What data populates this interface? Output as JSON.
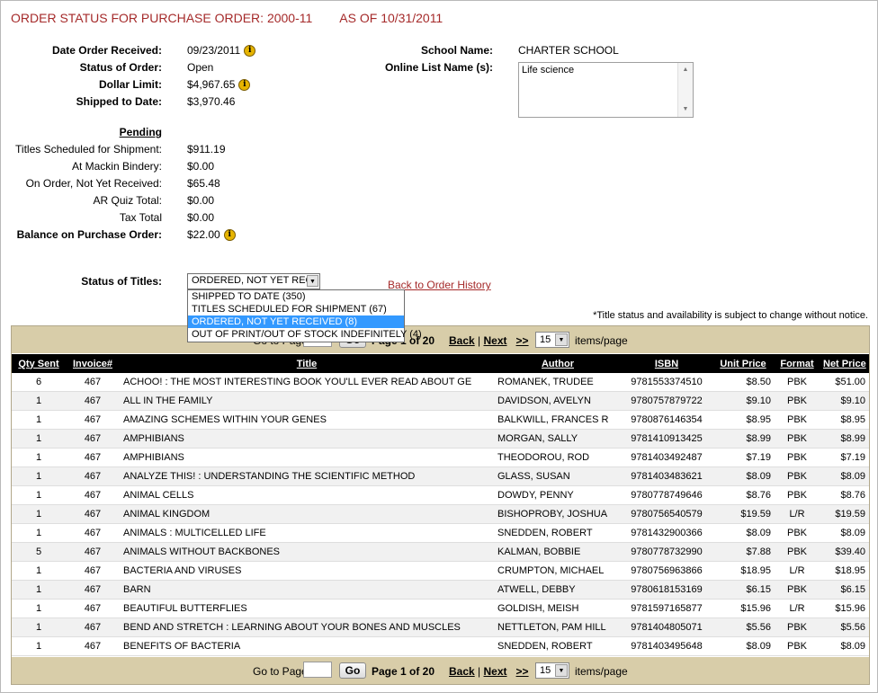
{
  "header": {
    "title": "ORDER STATUS FOR PURCHASE ORDER: 2000-11",
    "as_of": "AS OF 10/31/2011"
  },
  "order": {
    "date_label": "Date Order Received:",
    "date_value": "09/23/2011",
    "status_label": "Status of Order:",
    "status_value": "Open",
    "limit_label": "Dollar Limit:",
    "limit_value": "$4,967.65",
    "shipped_label": "Shipped to Date:",
    "shipped_value": "$3,970.46"
  },
  "school": {
    "label": "School Name:",
    "value": "CHARTER SCHOOL",
    "list_label": "Online List Name (s):",
    "list_value": "Life science"
  },
  "pending": {
    "heading": "Pending",
    "items": [
      {
        "label": "Titles Scheduled for Shipment:",
        "value": "$911.19"
      },
      {
        "label": "At Mackin Bindery:",
        "value": "$0.00"
      },
      {
        "label": "On Order, Not Yet Received:",
        "value": "$65.48"
      },
      {
        "label": "AR Quiz Total:",
        "value": "$0.00"
      },
      {
        "label": "Tax Total",
        "value": "$0.00"
      }
    ],
    "balance_label": "Balance on Purchase Order:",
    "balance_value": "$22.00"
  },
  "status_filter": {
    "label": "Status of Titles:",
    "selected": "ORDERED, NOT YET REC",
    "options": [
      "SHIPPED TO DATE (350)",
      "TITLES SCHEDULED FOR SHIPMENT (67)",
      "ORDERED, NOT YET RECEIVED (8)",
      "OUT OF PRINT/OUT OF STOCK INDEFINITELY (4)"
    ],
    "highlighted_index": 2
  },
  "back_link": "Back to Order History",
  "note": "*Title status and availability is subject to change without notice.",
  "pager": {
    "go_to": "Go to Page",
    "go": "Go",
    "page_info": "Page 1 of 20",
    "back": "Back",
    "sep": "|",
    "next": "Next",
    "last": ">>",
    "page_size": "15",
    "items_per_page": "items/page",
    "top_go_to_fragment": "Go to Page",
    "top_page_fragment": "Page 1 of 20"
  },
  "table": {
    "columns": [
      "Qty Sent",
      "Invoice#",
      "Title",
      "Author",
      "ISBN",
      "Unit Price",
      "Format",
      "Net Price"
    ],
    "rows": [
      [
        "6",
        "467",
        "ACHOO! : THE MOST INTERESTING BOOK YOU'LL EVER READ ABOUT GE",
        "ROMANEK, TRUDEE",
        "9781553374510",
        "$8.50",
        "PBK",
        "$51.00"
      ],
      [
        "1",
        "467",
        "ALL IN THE FAMILY",
        "DAVIDSON, AVELYN",
        "9780757879722",
        "$9.10",
        "PBK",
        "$9.10"
      ],
      [
        "1",
        "467",
        "AMAZING SCHEMES WITHIN YOUR GENES",
        "BALKWILL, FRANCES R",
        "9780876146354",
        "$8.95",
        "PBK",
        "$8.95"
      ],
      [
        "1",
        "467",
        "AMPHIBIANS",
        "MORGAN, SALLY",
        "9781410913425",
        "$8.99",
        "PBK",
        "$8.99"
      ],
      [
        "1",
        "467",
        "AMPHIBIANS",
        "THEODOROU, ROD",
        "9781403492487",
        "$7.19",
        "PBK",
        "$7.19"
      ],
      [
        "1",
        "467",
        "ANALYZE THIS! : UNDERSTANDING THE SCIENTIFIC METHOD",
        "GLASS, SUSAN",
        "9781403483621",
        "$8.09",
        "PBK",
        "$8.09"
      ],
      [
        "1",
        "467",
        "ANIMAL CELLS",
        "DOWDY, PENNY",
        "9780778749646",
        "$8.76",
        "PBK",
        "$8.76"
      ],
      [
        "1",
        "467",
        "ANIMAL KINGDOM",
        "BISHOPROBY, JOSHUA",
        "9780756540579",
        "$19.59",
        "L/R",
        "$19.59"
      ],
      [
        "1",
        "467",
        "ANIMALS : MULTICELLED LIFE",
        "SNEDDEN, ROBERT",
        "9781432900366",
        "$8.09",
        "PBK",
        "$8.09"
      ],
      [
        "5",
        "467",
        "ANIMALS WITHOUT BACKBONES",
        "KALMAN, BOBBIE",
        "9780778732990",
        "$7.88",
        "PBK",
        "$39.40"
      ],
      [
        "1",
        "467",
        "BACTERIA AND VIRUSES",
        "CRUMPTON, MICHAEL",
        "9780756963866",
        "$18.95",
        "L/R",
        "$18.95"
      ],
      [
        "1",
        "467",
        "BARN",
        "ATWELL, DEBBY",
        "9780618153169",
        "$6.15",
        "PBK",
        "$6.15"
      ],
      [
        "1",
        "467",
        "BEAUTIFUL BUTTERFLIES",
        "GOLDISH, MEISH",
        "9781597165877",
        "$15.96",
        "L/R",
        "$15.96"
      ],
      [
        "1",
        "467",
        "BEND AND STRETCH : LEARNING ABOUT YOUR BONES AND MUSCLES",
        "NETTLETON, PAM HILL",
        "9781404805071",
        "$5.56",
        "PBK",
        "$5.56"
      ],
      [
        "1",
        "467",
        "BENEFITS OF BACTERIA",
        "SNEDDEN, ROBERT",
        "9781403495648",
        "$8.09",
        "PBK",
        "$8.09"
      ]
    ]
  }
}
